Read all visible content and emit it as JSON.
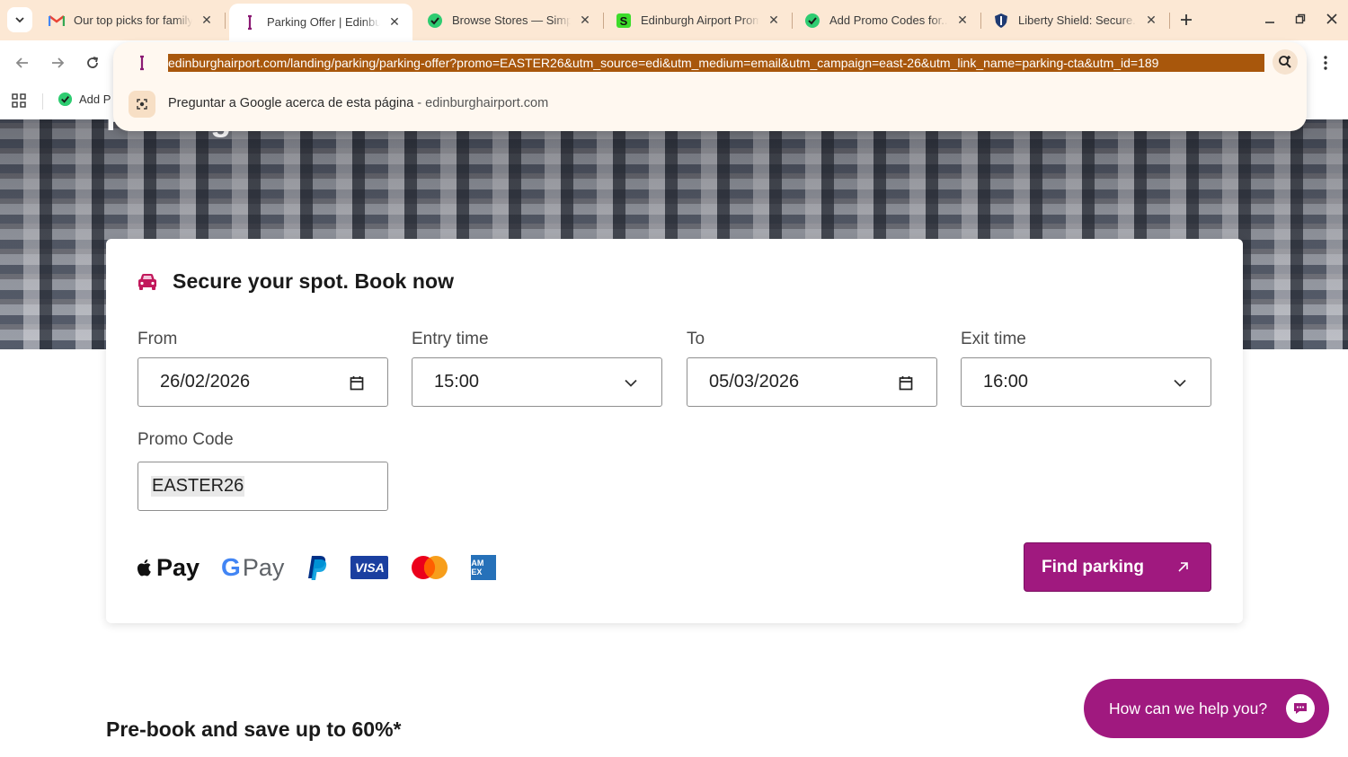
{
  "browser": {
    "tabs": [
      {
        "title": "Our top picks for family...",
        "favicon": "gmail-icon",
        "active": false
      },
      {
        "title": "Parking Offer | Edinburgh Airport",
        "favicon": "edinburgh-airport-icon",
        "active": true
      },
      {
        "title": "Browse Stores — SimplyCodes",
        "favicon": "simplycodes-icon",
        "active": false
      },
      {
        "title": "Edinburgh Airport Promo Codes",
        "favicon": "s-icon",
        "active": false
      },
      {
        "title": "Add Promo Codes for...",
        "favicon": "simplycodes-icon",
        "active": false
      },
      {
        "title": "Liberty Shield: Secure...",
        "favicon": "shield-icon",
        "active": false
      }
    ],
    "url": "edinburghairport.com/landing/parking/parking-offer?promo=EASTER26&utm_source=edi&utm_medium=email&utm_campaign=east-26&utm_link_name=parking-cta&utm_id=189",
    "suggestion": {
      "text": "Preguntar a Google acerca de esta página",
      "separator": " - ",
      "domain": "edinburghairport.com"
    },
    "bookmark_label": "Add P"
  },
  "hero": {
    "title": "Parking Offer"
  },
  "booking": {
    "heading": "Secure your spot. Book now",
    "from_label": "From",
    "from_value": "26/02/2026",
    "entry_label": "Entry time",
    "entry_value": "15:00",
    "to_label": "To",
    "to_value": "05/03/2026",
    "exit_label": "Exit time",
    "exit_value": "16:00",
    "promo_label": "Promo Code",
    "promo_value": "EASTER26",
    "find_button": "Find parking",
    "payments": {
      "apple": "Pay",
      "google_g": "G",
      "google": "Pay",
      "visa": "VISA",
      "amex": "AM EX"
    }
  },
  "section": {
    "title": "Pre-book and save up to 60%*"
  },
  "chat": {
    "label": "How can we help you?"
  },
  "colors": {
    "brand": "#a0197f",
    "tabstrip": "#fce8d4",
    "url_highlight": "#a8570c"
  }
}
